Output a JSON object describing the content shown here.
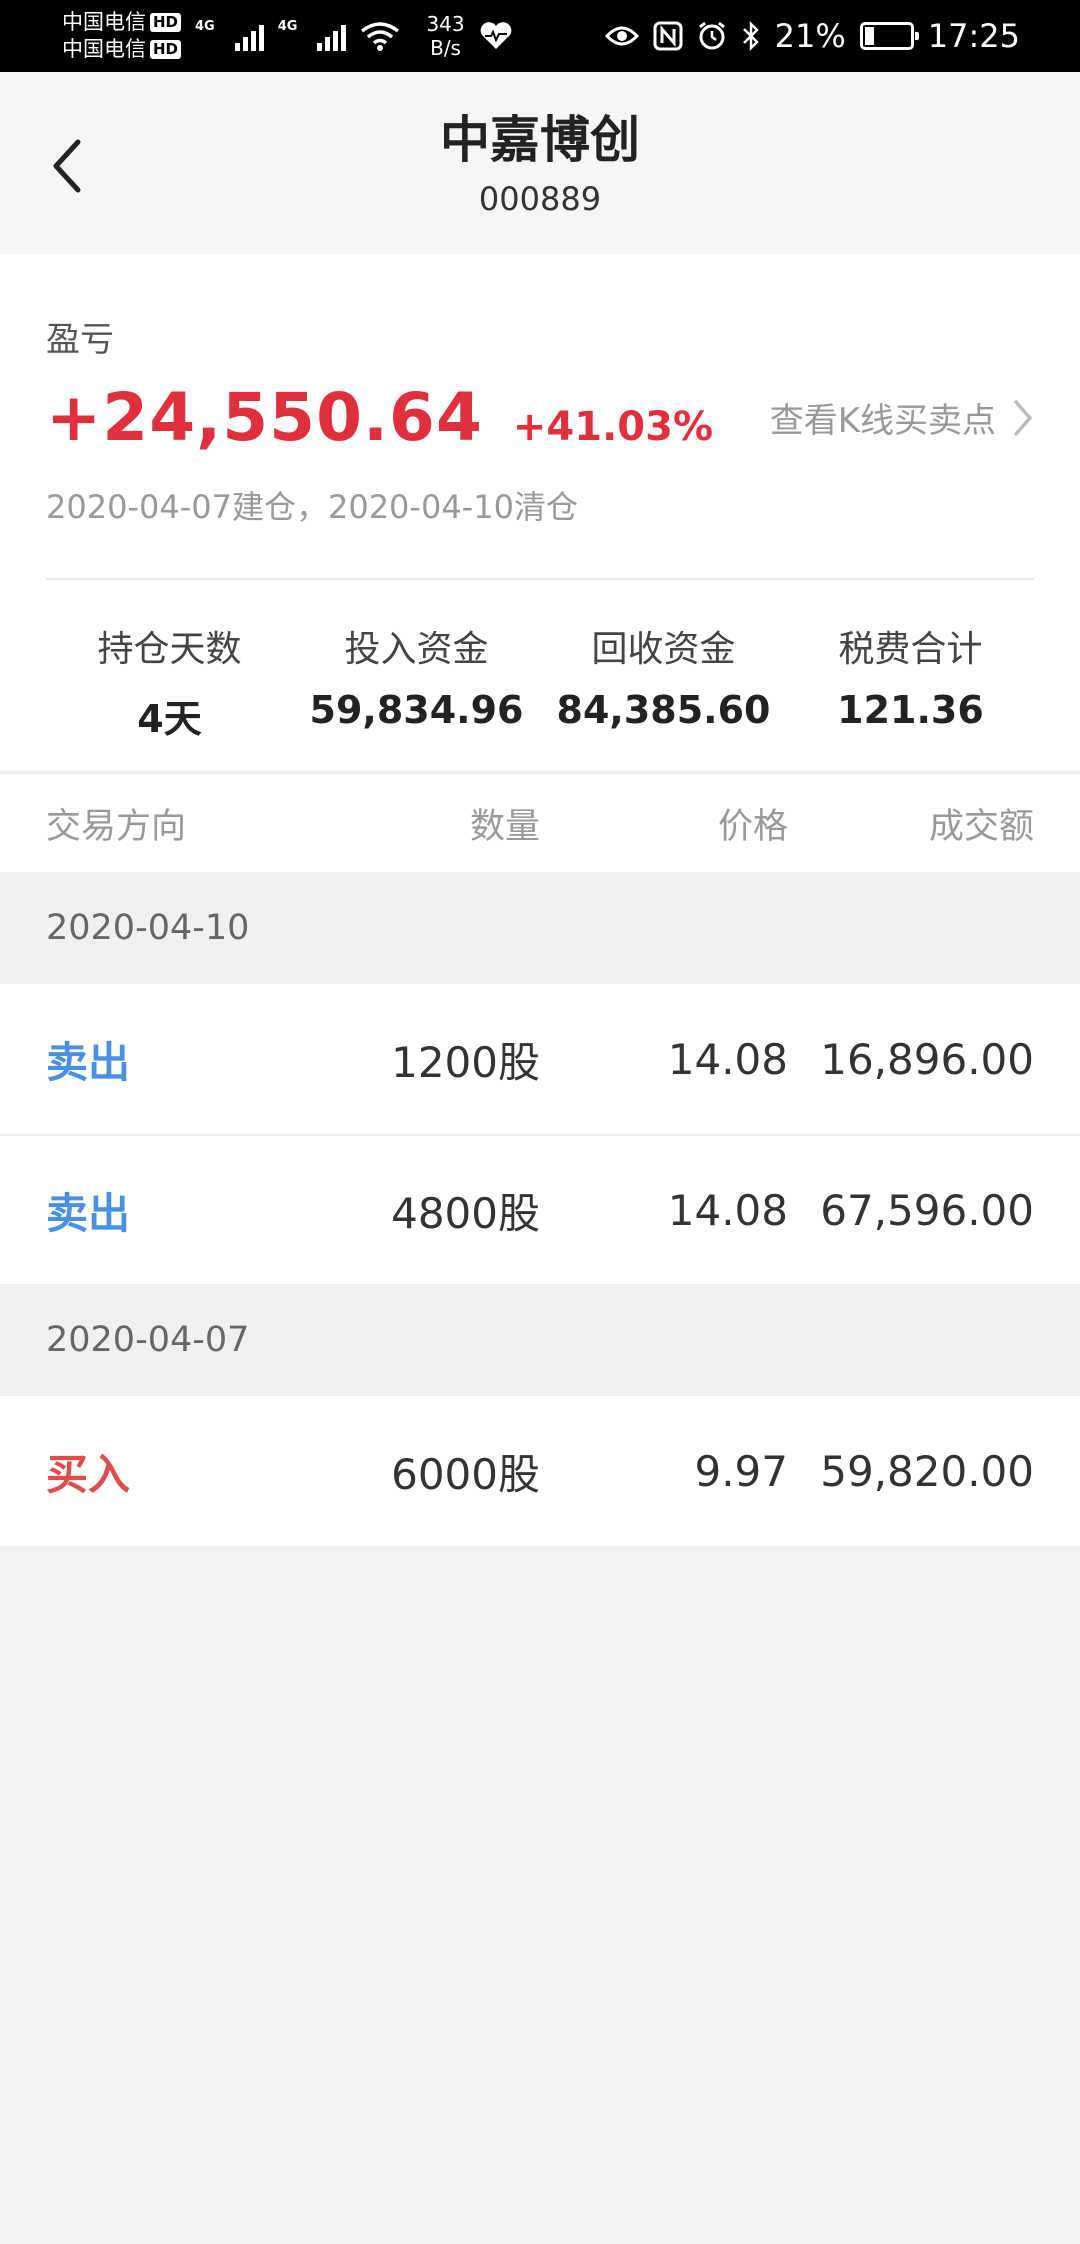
{
  "status_bar": {
    "carrier1": "中国电信",
    "carrier2": "中国电信",
    "hd": "HD",
    "network": "4G",
    "net_speed_value": "343",
    "net_speed_unit": "B/s",
    "battery_percent": "21%",
    "battery_level": 0.21,
    "time": "17:25"
  },
  "header": {
    "title": "中嘉博创",
    "code": "000889"
  },
  "summary": {
    "pl_label": "盈亏",
    "pl_amount": "+24,550.64",
    "pl_percent": "+41.03%",
    "kline_link": "查看K线买卖点",
    "dates_text": "2020-04-07建仓，2020-04-10清仓",
    "stats": [
      {
        "label": "持仓天数",
        "value": "4天"
      },
      {
        "label": "投入资金",
        "value": "59,834.96"
      },
      {
        "label": "回收资金",
        "value": "84,385.60"
      },
      {
        "label": "税费合计",
        "value": "121.36"
      }
    ]
  },
  "table": {
    "headers": [
      "交易方向",
      "数量",
      "价格",
      "成交额"
    ],
    "groups": [
      {
        "date": "2020-04-10",
        "rows": [
          {
            "direction": "卖出",
            "quantity": "1200股",
            "price": "14.08",
            "amount": "16,896.00"
          },
          {
            "direction": "卖出",
            "quantity": "4800股",
            "price": "14.08",
            "amount": "67,596.00"
          }
        ]
      },
      {
        "date": "2020-04-07",
        "rows": [
          {
            "direction": "买入",
            "quantity": "6000股",
            "price": "9.97",
            "amount": "59,820.00"
          }
        ]
      }
    ]
  },
  "colors": {
    "profit_red": "#e0303d",
    "sell_blue": "#4a90e2",
    "buy_red": "#e04b4b"
  }
}
